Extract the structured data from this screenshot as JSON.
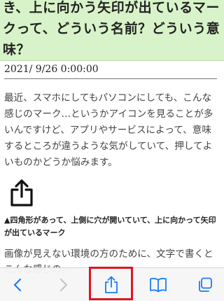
{
  "article": {
    "title": "き、上に向かう矢印が出ているマークって、どういう名前？どういう意味？",
    "date": "2021/ 9/26 0:00:00",
    "intro": "最近、スマホにしてもパソコンにしても、こんな感じのマーク…というかアイコンを見ることが多いんですけど、アプリやサービスによって、意味するところが違うような気がしていて、押してよいものかどうか悩みます。",
    "image_caption": "▲四角形があって、上側に穴が開いていて、上に向かって矢印が出ているマーク",
    "paragraph2": "画像が見えない環境の方のために、文字で書くとこんな感じの。"
  },
  "toolbar": {
    "buttons": [
      {
        "name": "back",
        "icon": "chevron-left-icon",
        "enabled": true
      },
      {
        "name": "forward",
        "icon": "chevron-right-icon",
        "enabled": false
      },
      {
        "name": "share",
        "icon": "share-icon",
        "enabled": true,
        "highlighted": true
      },
      {
        "name": "bookmarks",
        "icon": "book-icon",
        "enabled": true
      },
      {
        "name": "tabs",
        "icon": "tabs-icon",
        "enabled": true
      }
    ]
  },
  "colors": {
    "title_bg": "#d8f3c9",
    "toolbar_tint": "#1a7cf5",
    "disabled": "#c4c4c8",
    "highlight": "#e0141e"
  }
}
